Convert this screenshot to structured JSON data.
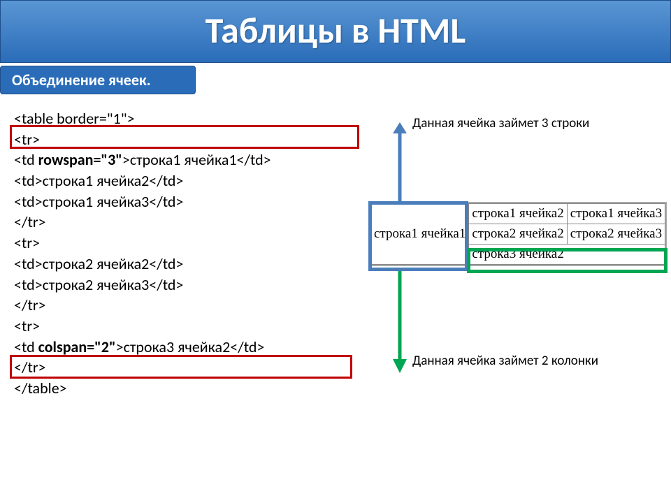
{
  "title": "Таблицы в HTML",
  "subtitle": "Объединение ячеек.",
  "code": {
    "l1": "<table border=\"1\">",
    "l2": "<tr>",
    "l3_open": "<td ",
    "l3_attr": "rowspan=\"3\"",
    "l3_rest": ">строка1 ячейка1</td>",
    "l4": "<td>строка1 ячейка2</td>",
    "l5": "<td>строка1 ячейка3</td>",
    "l6": "</tr>",
    "l7": "<tr>",
    "l8": "<td>строка2 ячейка2</td>",
    "l9": "<td>строка2 ячейка3</td>",
    "l10": "</tr>",
    "l11": "<tr>",
    "l12_open": "<td ",
    "l12_attr": "colspan=\"2\"",
    "l12_rest": ">строка3 ячейка2</td>",
    "l13": "</tr>",
    "l14": "</table>"
  },
  "annotation1": "Данная ячейка займет 3 строки",
  "annotation2": "Данная ячейка займет 2 колонки",
  "table": {
    "r1c1": "строка1 ячейка1",
    "r1c2": "строка1 ячейка2",
    "r1c3": "строка1 ячейка3",
    "r2c2": "строка2 ячейка2",
    "r2c3": "строка2 ячейка3",
    "r3c2": "строка3 ячейка2"
  }
}
